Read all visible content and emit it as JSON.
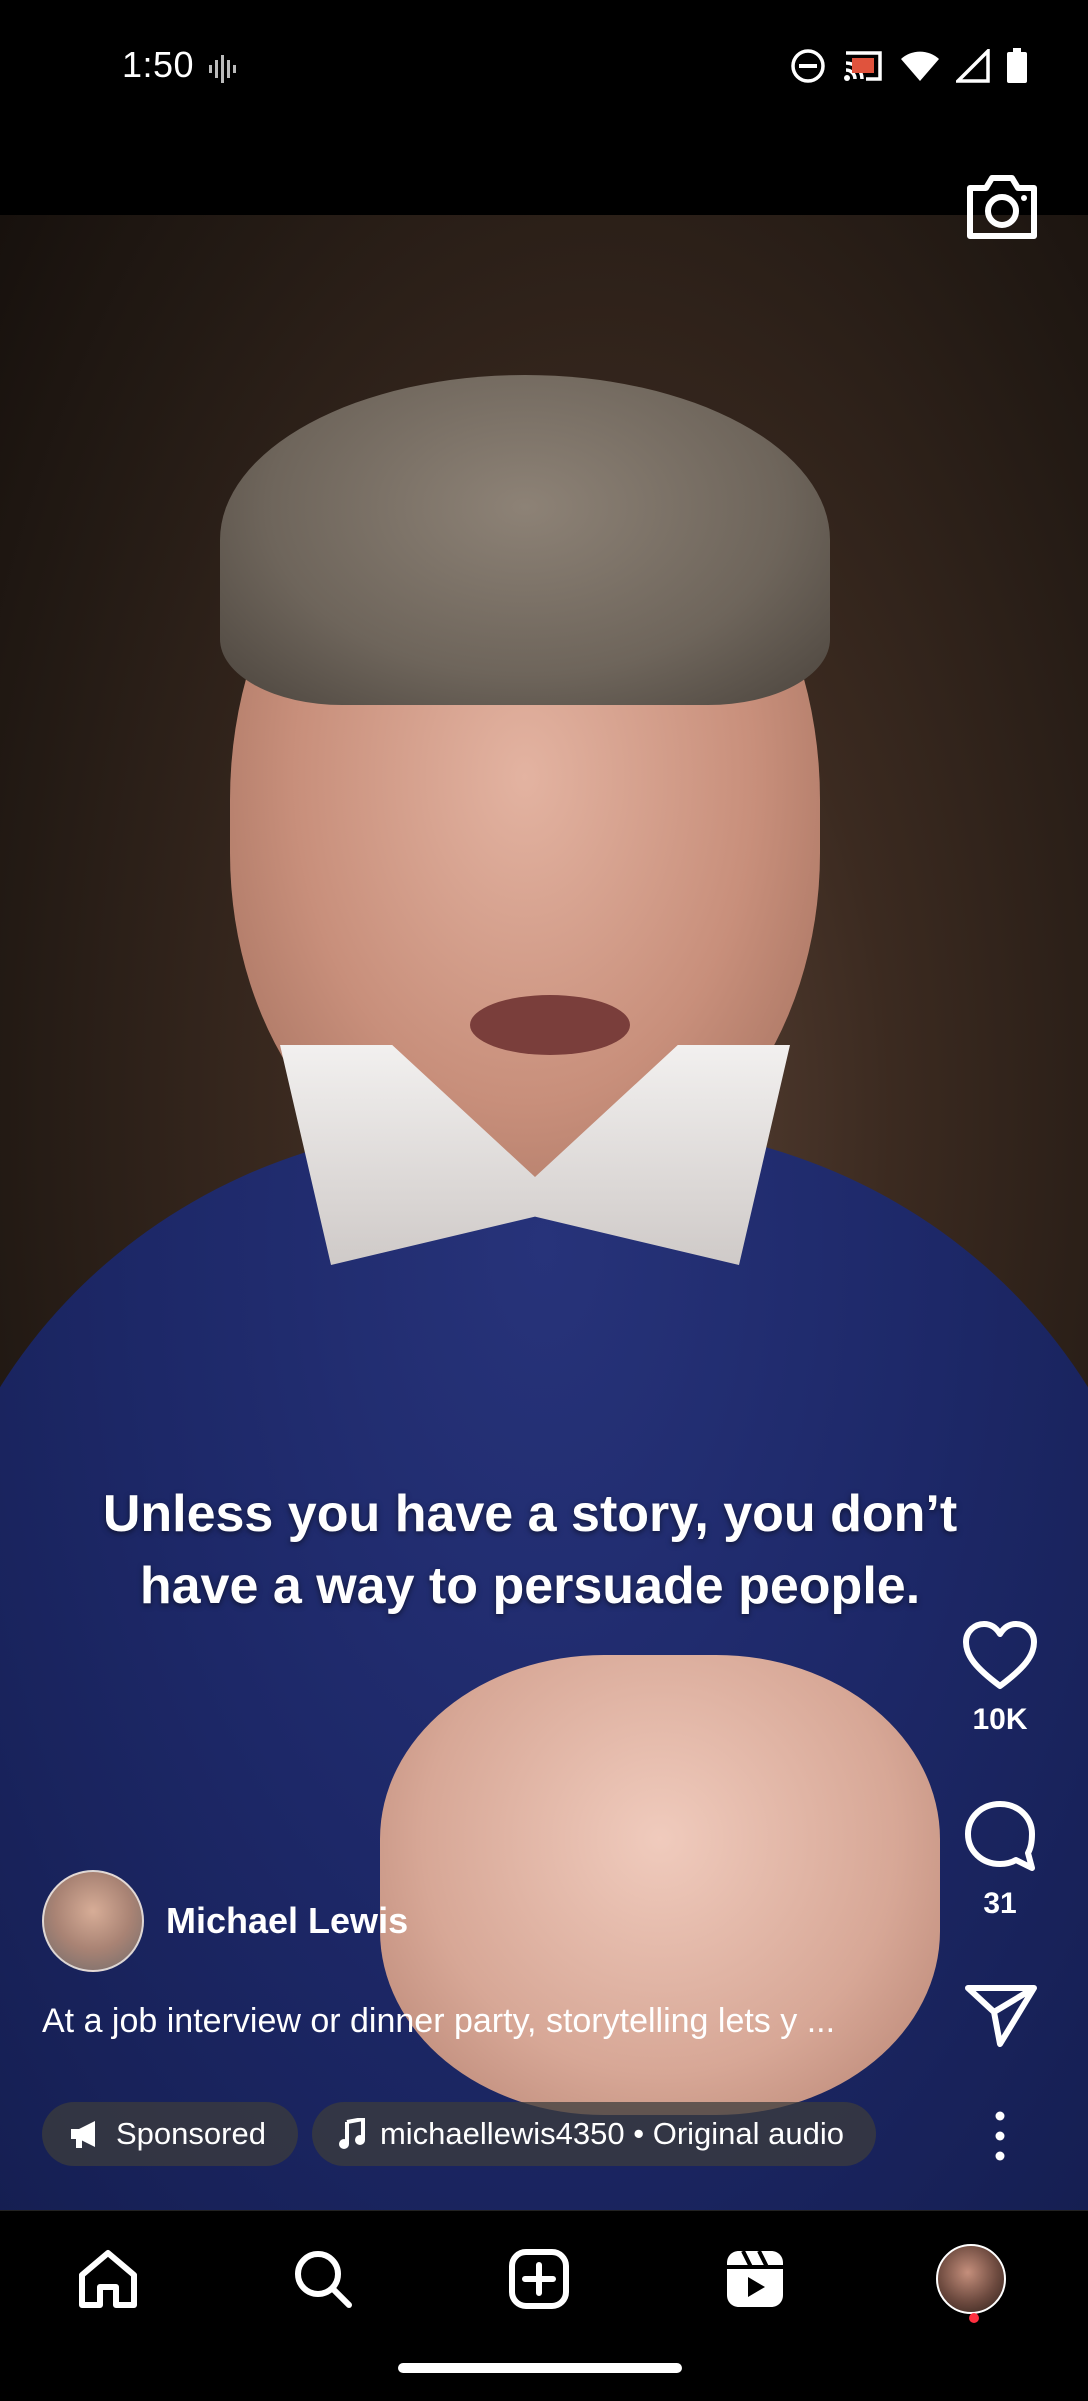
{
  "status_bar": {
    "time": "1:50",
    "icons": [
      "sound-wave-icon",
      "do-not-disturb-icon",
      "cast-icon",
      "wifi-icon",
      "signal-icon",
      "battery-icon"
    ]
  },
  "video": {
    "caption_line1": "Unless you have a story, you don’t",
    "caption_line2": "have a way to persuade people."
  },
  "actions": {
    "like_count": "10K",
    "comment_count": "31"
  },
  "author": {
    "name": "Michael Lewis"
  },
  "description": "At a job interview or dinner party, storytelling lets y ...",
  "chips": {
    "sponsored": "Sponsored",
    "audio": "michaellewis4350 • Original audio"
  },
  "nav": [
    "home-icon",
    "search-icon",
    "create-icon",
    "reels-icon",
    "profile-avatar"
  ],
  "colors": {
    "accent_dot": "#ff3040",
    "sweater": "#1d2868"
  }
}
